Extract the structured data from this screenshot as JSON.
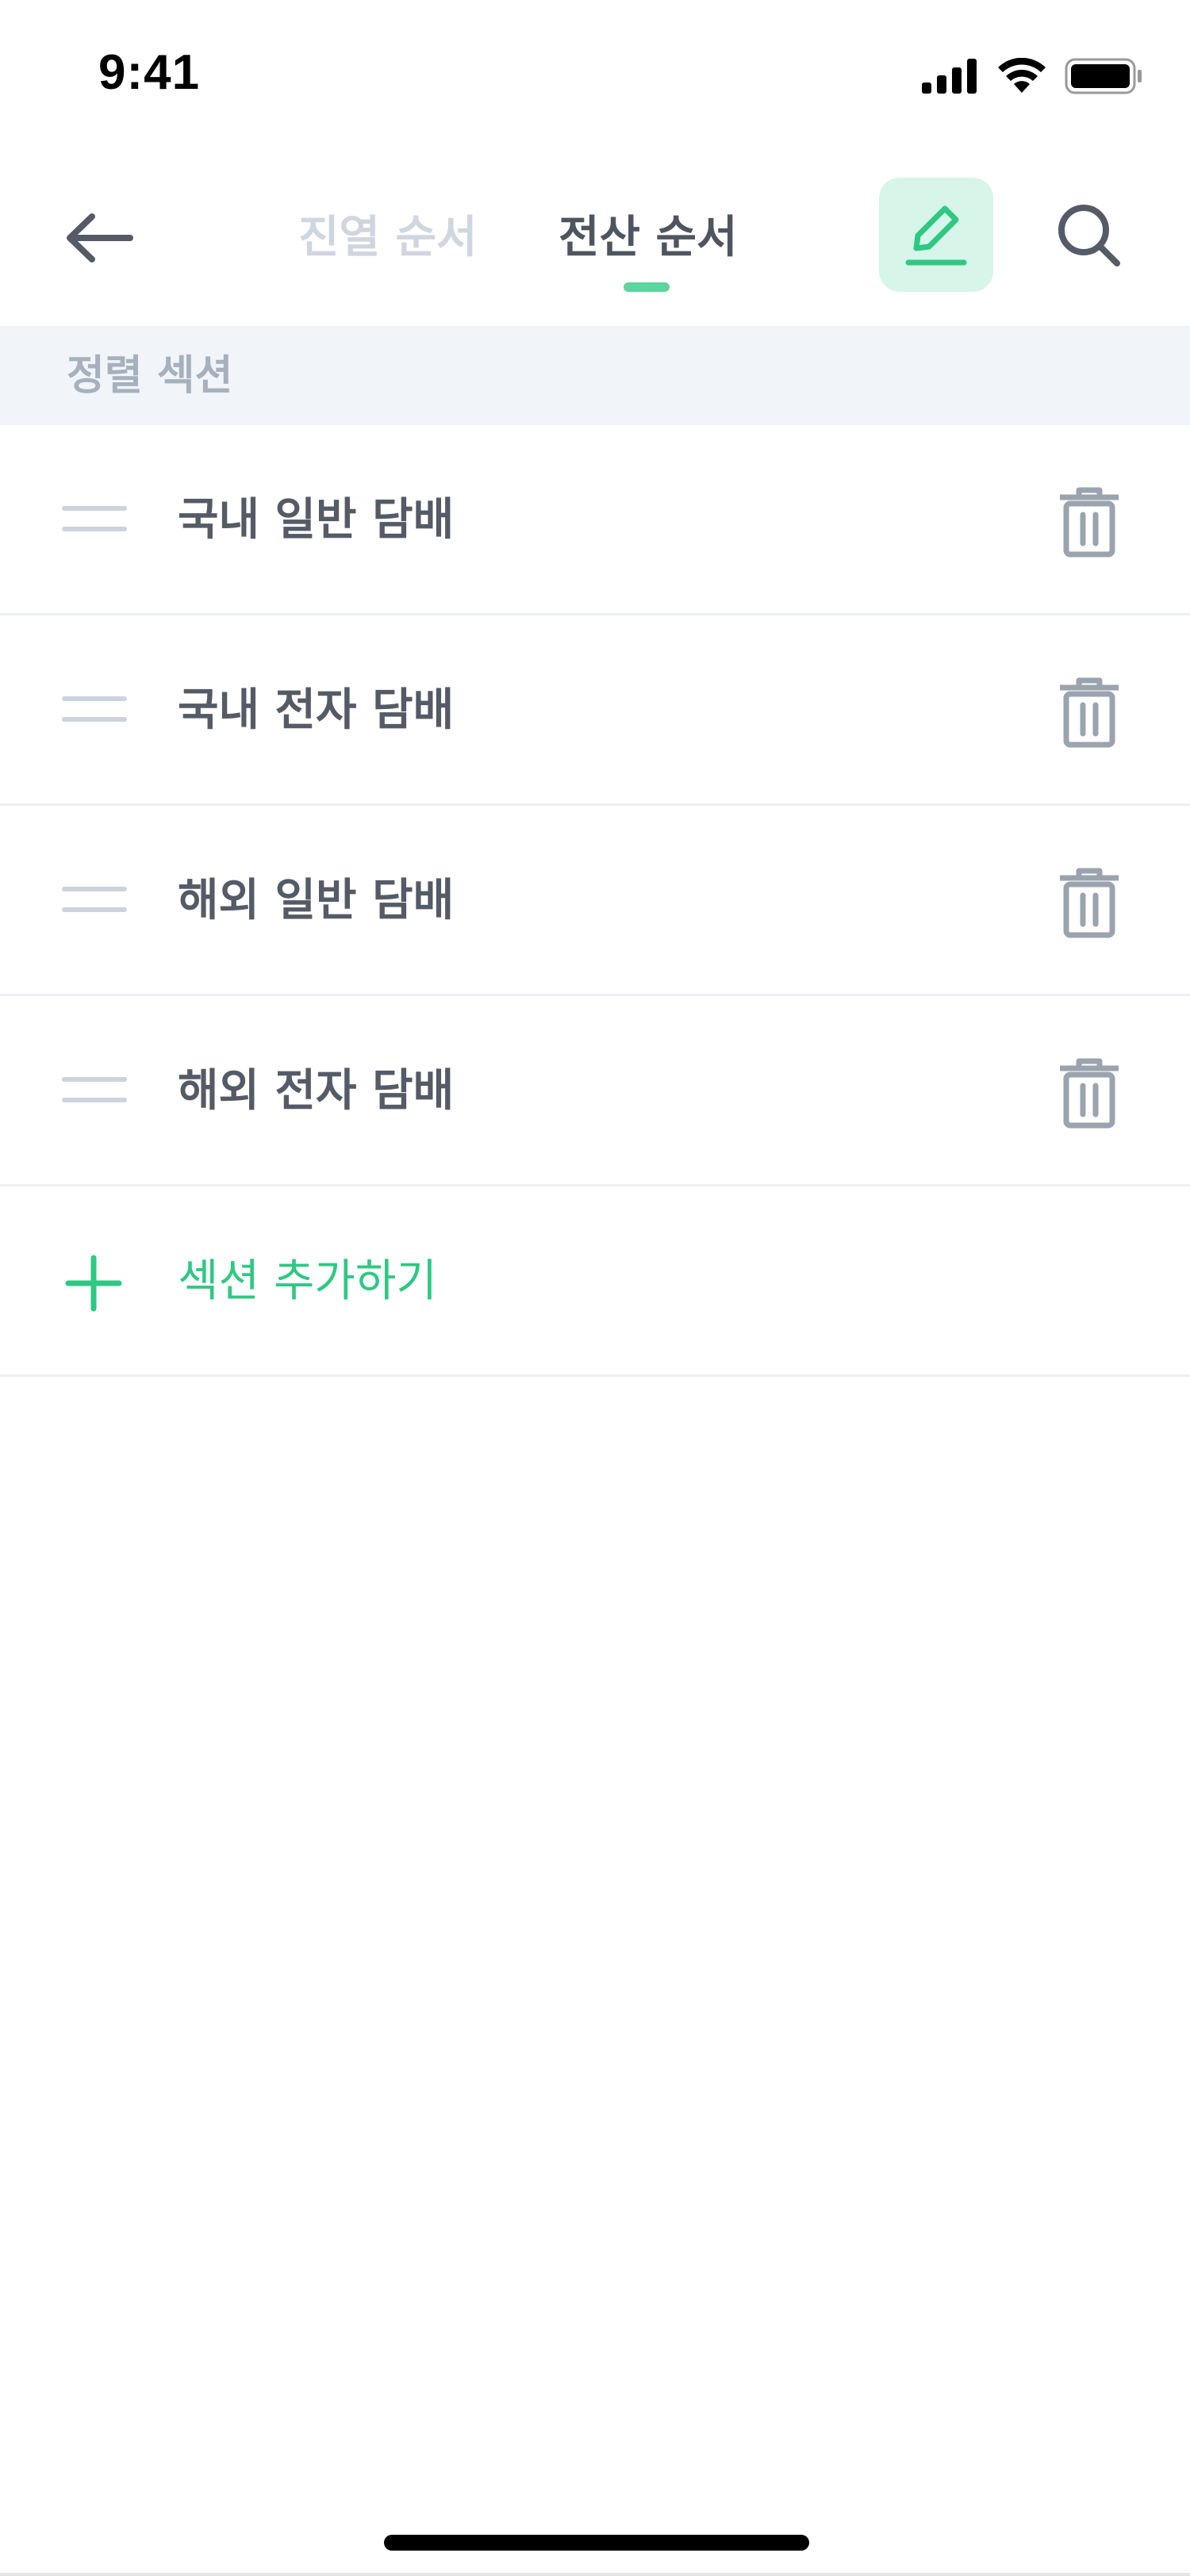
{
  "status_bar": {
    "time": "9:41",
    "icons": [
      "signal-icon",
      "wifi-icon",
      "battery-icon"
    ]
  },
  "header": {
    "back_icon": "arrow-left-icon",
    "tabs": [
      {
        "label": "진열 순서",
        "active": false
      },
      {
        "label": "전산 순서",
        "active": true
      }
    ],
    "edit_icon": "pencil-icon",
    "search_icon": "search-icon"
  },
  "section": {
    "title": "정렬 섹션",
    "items": [
      {
        "label": "국내 일반 담배"
      },
      {
        "label": "국내 전자 담배"
      },
      {
        "label": "해외 일반 담배"
      },
      {
        "label": "해외 전자 담배"
      }
    ],
    "add_label": "섹션 추가하기"
  },
  "colors": {
    "accent": "#2fc882",
    "accent_bg": "#d7f5e8",
    "text_primary": "#555b66",
    "text_muted": "#a7b0bd",
    "section_bg": "#f1f5fa",
    "icon_gray": "#9aa3ae"
  }
}
